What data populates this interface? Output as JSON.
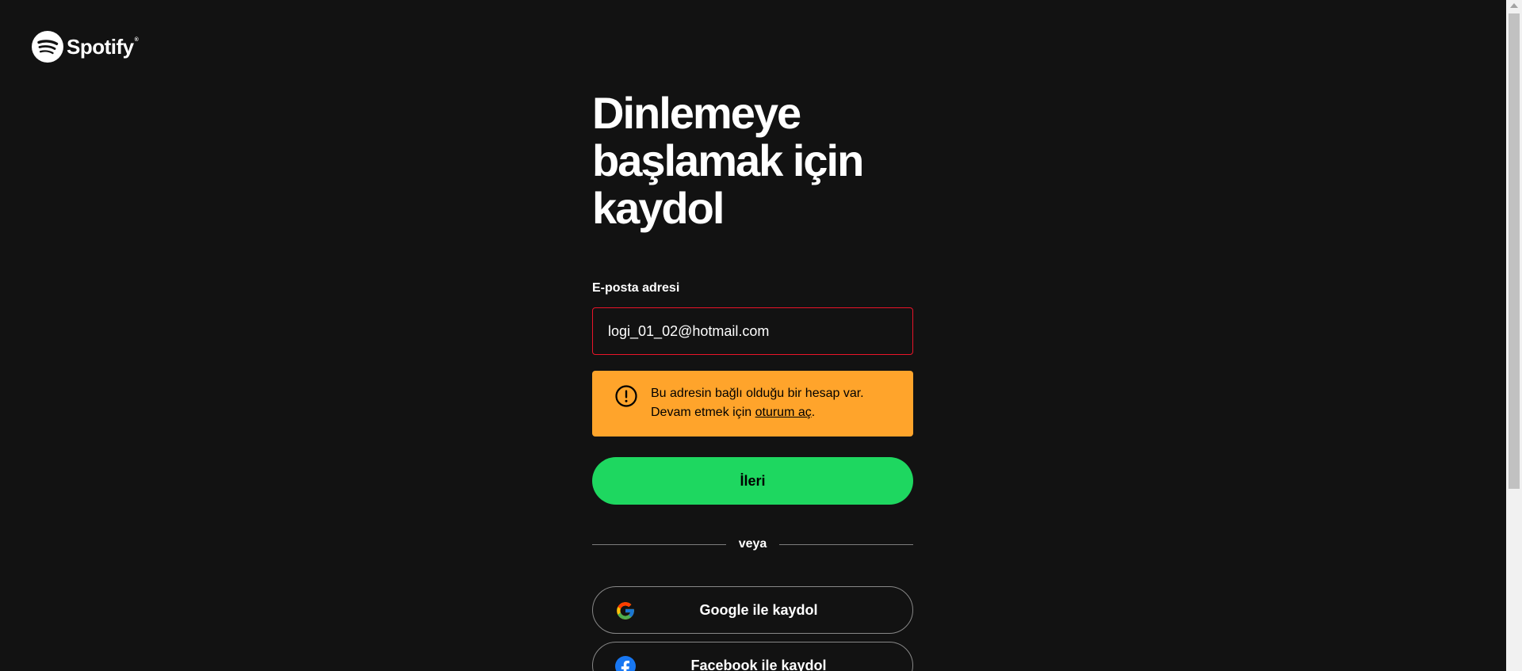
{
  "brand": {
    "name": "Spotify",
    "registered_mark": "®"
  },
  "signup": {
    "title": "Dinlemeye başlamak için kaydol",
    "email_label": "E-posta adresi",
    "email_value": "logi_01_02@hotmail.com",
    "alert": {
      "line1": "Bu adresin bağlı olduğu bir hesap var.",
      "line2_prefix": "Devam etmek için ",
      "link_text": "oturum aç",
      "line2_suffix": "."
    },
    "next_button": "İleri",
    "divider_text": "veya",
    "google_button": "Google ile kaydol",
    "facebook_button": "Facebook ile kaydol"
  },
  "colors": {
    "background": "#121212",
    "accent_green": "#1ed760",
    "alert_orange": "#ffa42b",
    "error_border": "#e91429",
    "facebook_blue": "#1877f2"
  },
  "icons": {
    "logo": "spotify-logo-icon",
    "alert": "exclamation-circle-icon",
    "google": "google-g-icon",
    "facebook": "facebook-f-icon"
  }
}
